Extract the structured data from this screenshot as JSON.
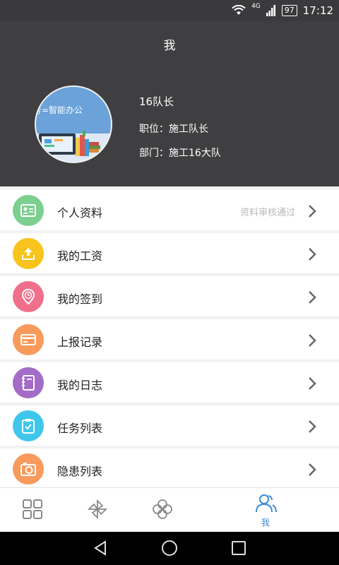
{
  "status_bar": {
    "network": "4G",
    "battery": "97",
    "time": "17:12"
  },
  "header": {
    "title": "我",
    "avatar_text": "号=智能办公",
    "name": "16队长",
    "position": "职位：施工队长",
    "department": "部门：施工16大队"
  },
  "menu": [
    {
      "label": "个人资料",
      "status": "资料审核通过",
      "icon": "id-card-icon",
      "color": "#7ccf8f"
    },
    {
      "label": "我的工资",
      "status": "",
      "icon": "upload-tray-icon",
      "color": "#f7c31c"
    },
    {
      "label": "我的签到",
      "status": "",
      "icon": "location-clock-icon",
      "color": "#f0708c"
    },
    {
      "label": "上报记录",
      "status": "",
      "icon": "card-icon",
      "color": "#f79a5c"
    },
    {
      "label": "我的日志",
      "status": "",
      "icon": "notebook-icon",
      "color": "#a46cc8"
    },
    {
      "label": "任务列表",
      "status": "",
      "icon": "clipboard-check-icon",
      "color": "#3fc7ea"
    },
    {
      "label": "隐患列表",
      "status": "",
      "icon": "camera-icon",
      "color": "#f79a5c"
    }
  ],
  "tabbar": {
    "tabs": [
      {
        "icon": "grid-icon",
        "label": ""
      },
      {
        "icon": "pinwheel-icon",
        "label": ""
      },
      {
        "icon": "clover-icon",
        "label": ""
      },
      {
        "icon": "users-icon",
        "label": "我"
      }
    ],
    "active_color": "#3d8ad6",
    "inactive_color": "#888888"
  },
  "navbar": {
    "buttons": [
      "back-icon",
      "home-icon",
      "recents-icon"
    ]
  }
}
